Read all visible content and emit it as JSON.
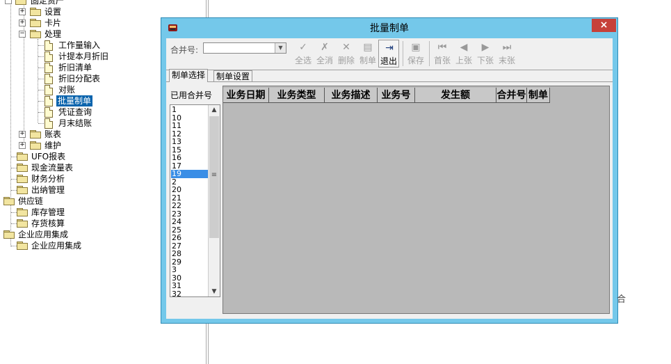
{
  "tree": {
    "items": [
      {
        "label": "固定资产"
      },
      {
        "label": "设置"
      },
      {
        "label": "卡片"
      },
      {
        "label": "处理"
      },
      {
        "label": "工作量输入"
      },
      {
        "label": "计提本月折旧"
      },
      {
        "label": "折旧清单"
      },
      {
        "label": "折旧分配表"
      },
      {
        "label": "对账"
      },
      {
        "label": "批量制单"
      },
      {
        "label": "凭证查询"
      },
      {
        "label": "月末结账"
      },
      {
        "label": "账表"
      },
      {
        "label": "维护"
      },
      {
        "label": "UFO报表"
      },
      {
        "label": "现金流量表"
      },
      {
        "label": "财务分析"
      },
      {
        "label": "出纳管理"
      },
      {
        "label": "供应链"
      },
      {
        "label": "库存管理"
      },
      {
        "label": "存货核算"
      },
      {
        "label": "企业应用集成"
      },
      {
        "label": "企业应用集成"
      }
    ],
    "expand_plus": "+",
    "expand_minus": "−"
  },
  "dialog": {
    "title": "批量制单",
    "close_glyph": "×",
    "merge_label": "合并号:",
    "merge_value": "",
    "toolbar": [
      {
        "label": "全选",
        "icon": "select-all-icon",
        "glyph": "✓"
      },
      {
        "label": "全消",
        "icon": "deselect-all-icon",
        "glyph": "✗"
      },
      {
        "label": "删除",
        "icon": "delete-icon",
        "glyph": "✕"
      },
      {
        "label": "制单",
        "icon": "make-voucher-icon",
        "glyph": "▤"
      },
      {
        "label": "退出",
        "icon": "exit-icon",
        "glyph": "⇥"
      },
      {
        "label": "保存",
        "icon": "save-icon",
        "glyph": "▣"
      },
      {
        "label": "首张",
        "icon": "first-icon",
        "glyph": "⏮"
      },
      {
        "label": "上张",
        "icon": "prev-icon",
        "glyph": "◀"
      },
      {
        "label": "下张",
        "icon": "next-icon",
        "glyph": "▶"
      },
      {
        "label": "末张",
        "icon": "last-icon",
        "glyph": "⏭"
      }
    ],
    "tabs": [
      "制单选择",
      "制单设置"
    ],
    "used_merge_label": "已用合并号",
    "merge_numbers": [
      "1",
      "10",
      "11",
      "12",
      "13",
      "15",
      "16",
      "17",
      "19",
      "2",
      "20",
      "21",
      "22",
      "23",
      "24",
      "25",
      "26",
      "27",
      "28",
      "29",
      "3",
      "30",
      "31",
      "32"
    ],
    "selected_merge": "19",
    "columns": [
      "业务日期",
      "业务类型",
      "业务描述",
      "业务号",
      "发生额",
      "合并号",
      "制单"
    ]
  },
  "colors": {
    "titlebar": "#74c8ea",
    "close": "#c7413a",
    "selection": "#0a64ad",
    "grid_bg": "#b9b9b9"
  }
}
